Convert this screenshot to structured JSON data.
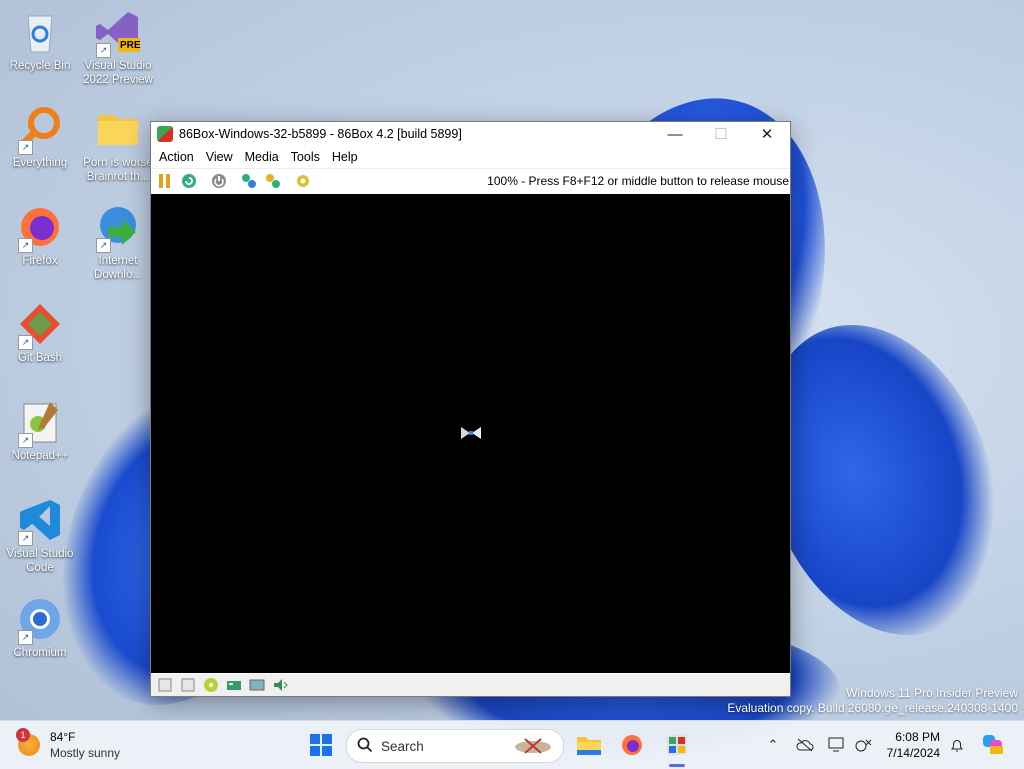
{
  "desktop": {
    "icons": [
      {
        "label": "Recycle Bin"
      },
      {
        "label": "Visual Studio 2022 Preview",
        "badge": "PRE"
      },
      {
        "label": "Everything"
      },
      {
        "label": "Porn is worse Brainrot th..."
      },
      {
        "label": "Firefox"
      },
      {
        "label": "Internet Downlo..."
      },
      {
        "label": "Git Bash"
      },
      {
        "label": "Notepad++"
      },
      {
        "label": "Visual Studio Code"
      },
      {
        "label": "Chromium"
      }
    ]
  },
  "window": {
    "title": "86Box-Windows-32-b5899 - 86Box 4.2 [build 5899]",
    "menu": [
      "Action",
      "View",
      "Media",
      "Tools",
      "Help"
    ],
    "status_message": "100% - Press F8+F12 or middle button to release mouse",
    "toolbar_icons": [
      "pause-icon",
      "reset-icon",
      "power-icon",
      "ctrl-alt-del-icon",
      "ctrl-alt-esc-icon",
      "settings-icon"
    ],
    "statusbar_icons": [
      "floppy-icon",
      "floppy-icon",
      "cdrom-icon",
      "hdd-icon",
      "network-icon",
      "sound-icon"
    ]
  },
  "watermark": {
    "line1": "Windows 11 Pro Insider Preview",
    "line2": "Evaluation copy. Build 26080.ge_release.240308-1400"
  },
  "taskbar": {
    "weather_badge": "1",
    "temperature": "84°F",
    "condition": "Mostly sunny",
    "search_placeholder": "Search",
    "time": "6:08 PM",
    "date": "7/14/2024"
  },
  "colors": {
    "accent": "#0a64d8",
    "screen": "#000000"
  }
}
